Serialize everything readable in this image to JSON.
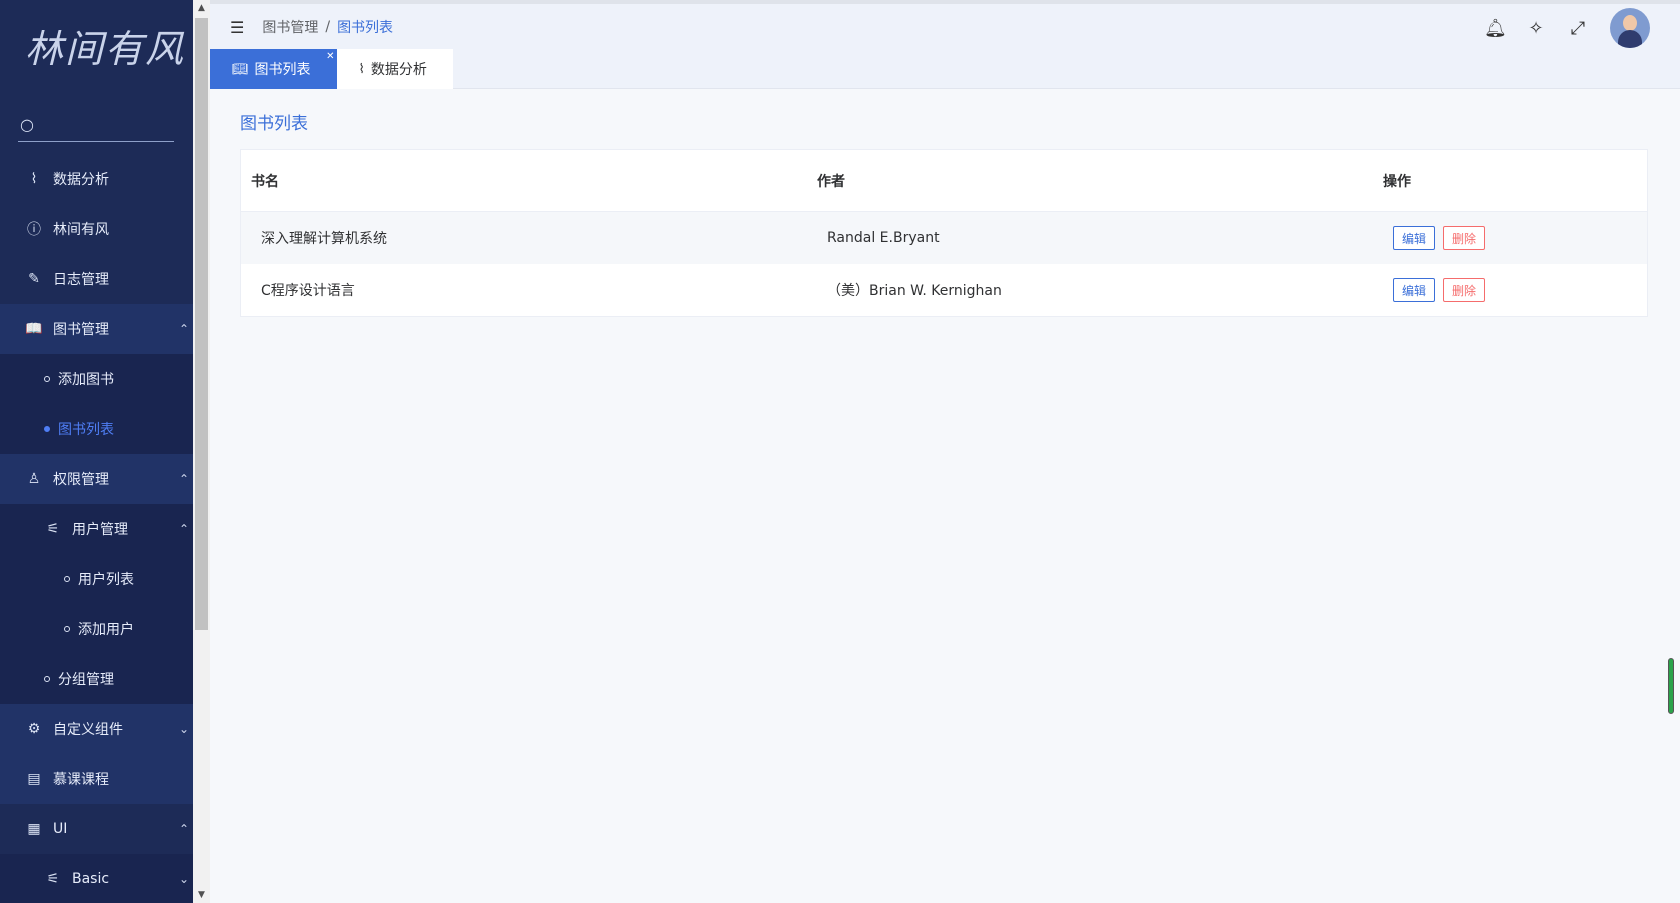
{
  "sidebar": {
    "logo": "林间有风",
    "items": [
      {
        "label": "数据分析"
      },
      {
        "label": "林间有风"
      },
      {
        "label": "日志管理"
      },
      {
        "label": "图书管理"
      },
      {
        "label": "添加图书"
      },
      {
        "label": "图书列表"
      },
      {
        "label": "权限管理"
      },
      {
        "label": "用户管理"
      },
      {
        "label": "用户列表"
      },
      {
        "label": "添加用户"
      },
      {
        "label": "分组管理"
      },
      {
        "label": "自定义组件"
      },
      {
        "label": "慕课课程"
      },
      {
        "label": "UI"
      },
      {
        "label": "Basic"
      }
    ]
  },
  "header": {
    "breadcrumb": {
      "parent": "图书管理",
      "separator": "/",
      "current": "图书列表"
    }
  },
  "tabs": [
    {
      "label": "图书列表",
      "active": true
    },
    {
      "label": "数据分析",
      "active": false
    }
  ],
  "main": {
    "title": "图书列表",
    "columns": [
      "书名",
      "作者",
      "操作"
    ],
    "rows": [
      {
        "title": "深入理解计算机系统",
        "author": "Randal E.Bryant",
        "edit": "编辑",
        "delete": "删除"
      },
      {
        "title": "C程序设计语言",
        "author": "（美）Brian W. Kernighan",
        "edit": "编辑",
        "delete": "删除"
      }
    ]
  },
  "colors": {
    "accent": "#3b6fd8",
    "sidebar": "#1d2b57",
    "danger": "#f56c6c"
  }
}
